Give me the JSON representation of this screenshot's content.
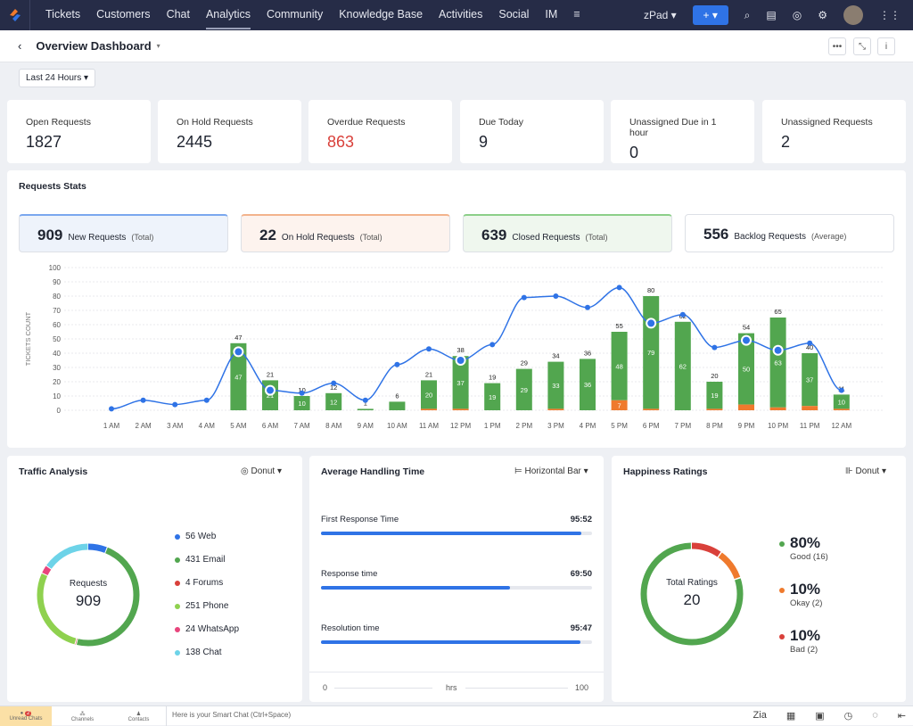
{
  "nav": {
    "items": [
      "Tickets",
      "Customers",
      "Chat",
      "Analytics",
      "Community",
      "Knowledge Base",
      "Activities",
      "Social",
      "IM"
    ],
    "active": "Analytics",
    "zpad": "zPad",
    "plus": "+"
  },
  "header": {
    "title": "Overview Dashboard",
    "filter": "Last 24 Hours"
  },
  "kpis": [
    {
      "label": "Open Requests",
      "value": "1827"
    },
    {
      "label": "On Hold Requests",
      "value": "2445"
    },
    {
      "label": "Overdue Requests",
      "value": "863",
      "color": "#d9403a"
    },
    {
      "label": "Due Today",
      "value": "9"
    },
    {
      "label": "Unassigned Due in 1 hour",
      "value": "0"
    },
    {
      "label": "Unassigned Requests",
      "value": "2"
    }
  ],
  "requests_stats": {
    "title": "Requests Stats",
    "cards": [
      {
        "value": "909",
        "label": "New Requests",
        "suffix": "(Total)"
      },
      {
        "value": "22",
        "label": "On Hold Requests",
        "suffix": "(Total)"
      },
      {
        "value": "639",
        "label": "Closed Requests",
        "suffix": "(Total)"
      },
      {
        "value": "556",
        "label": "Backlog Requests",
        "suffix": "(Average)"
      }
    ]
  },
  "chart_data": {
    "type": "bar",
    "ylabel": "TICKETS COUNT",
    "ylim": [
      0,
      100
    ],
    "yticks": [
      0,
      10,
      20,
      30,
      40,
      50,
      60,
      70,
      80,
      90,
      100
    ],
    "grid": true,
    "categories": [
      "1 AM",
      "2 AM",
      "3 AM",
      "4 AM",
      "5 AM",
      "6 AM",
      "7 AM",
      "8 AM",
      "9 AM",
      "10 AM",
      "11 AM",
      "12 PM",
      "1 PM",
      "2 PM",
      "3 PM",
      "4 PM",
      "5 PM",
      "6 PM",
      "7 PM",
      "8 PM",
      "9 PM",
      "10 PM",
      "11 PM",
      "12 AM"
    ],
    "totals": [
      null,
      null,
      null,
      null,
      47,
      21,
      10,
      12,
      1,
      6,
      21,
      38,
      19,
      29,
      34,
      36,
      55,
      80,
      62,
      20,
      54,
      65,
      40,
      11
    ],
    "series": [
      {
        "type": "bar",
        "color": "#52a64f",
        "values": [
          0,
          0,
          0,
          0,
          47,
          21,
          10,
          12,
          1,
          6,
          20,
          37,
          19,
          29,
          33,
          36,
          48,
          79,
          62,
          19,
          50,
          63,
          37,
          10
        ]
      },
      {
        "type": "bar",
        "color": "#ef7a2d",
        "values": [
          0,
          0,
          0,
          0,
          0,
          0,
          0,
          0,
          0,
          0,
          1,
          1,
          0,
          0,
          1,
          0,
          7,
          1,
          0,
          1,
          4,
          2,
          3,
          1
        ]
      },
      {
        "type": "line",
        "color": "#2f73e6",
        "values": [
          1,
          7,
          4,
          7,
          41,
          14,
          12,
          19,
          7,
          32,
          43,
          35,
          46,
          79,
          80,
          72,
          86,
          61,
          67,
          44,
          49,
          42,
          47,
          14
        ]
      }
    ]
  },
  "traffic": {
    "title": "Traffic Analysis",
    "chart_type": "Donut",
    "center_label": "Requests",
    "center_value": "909",
    "items": [
      {
        "label": "56 Web",
        "color": "#2f73e6",
        "value": 56
      },
      {
        "label": "431 Email",
        "color": "#52a64f",
        "value": 431
      },
      {
        "label": "4 Forums",
        "color": "#d9403a",
        "value": 4
      },
      {
        "label": "251 Phone",
        "color": "#8fd14f",
        "value": 251
      },
      {
        "label": "24 WhatsApp",
        "color": "#e8457c",
        "value": 24
      },
      {
        "label": "138 Chat",
        "color": "#6dd3e8",
        "value": 138
      }
    ]
  },
  "aht": {
    "title": "Average Handling Time",
    "chart_type": "Horizontal Bar",
    "rows": [
      {
        "label": "First Response Time",
        "value": "95:52",
        "pct": 95.9
      },
      {
        "label": "Response time",
        "value": "69:50",
        "pct": 69.8
      },
      {
        "label": "Resolution time",
        "value": "95:47",
        "pct": 95.8
      }
    ],
    "axis": {
      "min": "0",
      "unit": "hrs",
      "max": "100"
    }
  },
  "happiness": {
    "title": "Happiness Ratings",
    "chart_type": "Donut",
    "center_label": "Total Ratings",
    "center_value": "20",
    "items": [
      {
        "pct": "80%",
        "label": "Good (16)",
        "color": "#52a64f",
        "value": 16
      },
      {
        "pct": "10%",
        "label": "Okay (2)",
        "color": "#ef7a2d",
        "value": 2
      },
      {
        "pct": "10%",
        "label": "Bad (2)",
        "color": "#d9403a",
        "value": 2
      }
    ]
  },
  "bottom": {
    "unread": "Unread Chats",
    "unread_count": "2",
    "channels": "Channels",
    "contacts": "Contacts",
    "smart_chat": "Here is your Smart Chat (Ctrl+Space)",
    "zia": "Zia"
  }
}
